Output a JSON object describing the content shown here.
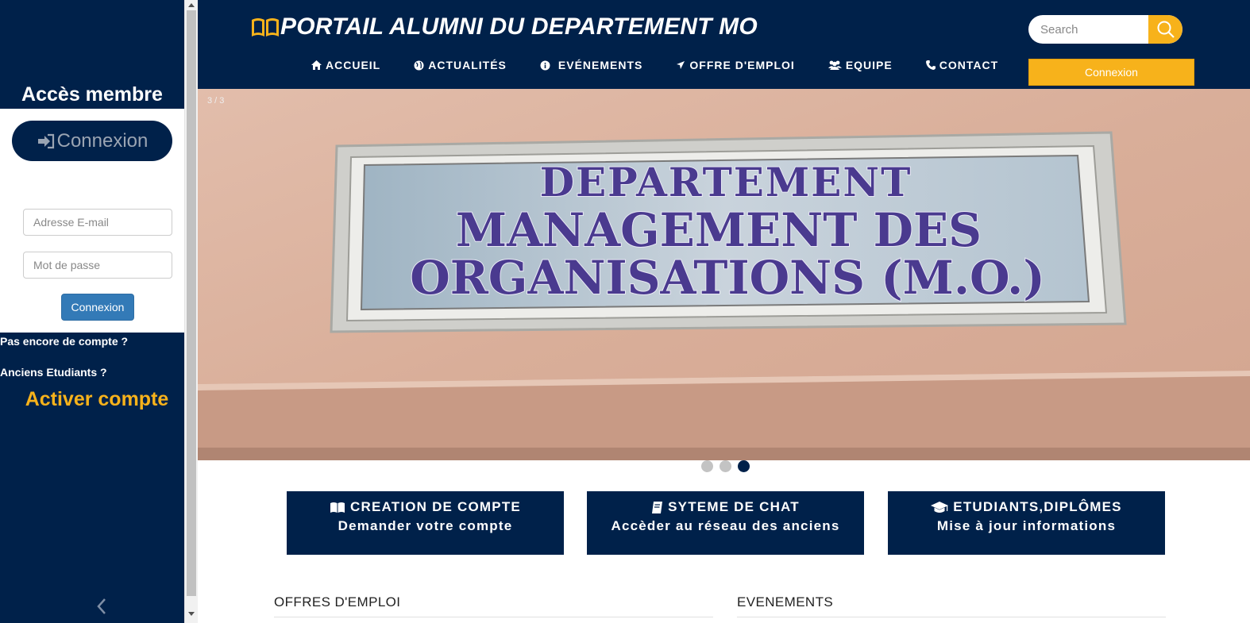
{
  "sidebar": {
    "title": "Accès membre",
    "connect_pill": "Connexion",
    "email_placeholder": "Adresse E-mail",
    "password_placeholder": "Mot de passe",
    "submit": "Connexion",
    "no_account": "Pas encore de compte ?",
    "old_students": "Anciens Etudiants ?",
    "activate": "Activer compte"
  },
  "header": {
    "title": "PORTAIL ALUMNI DU DEPARTEMENT MO",
    "search_placeholder": "Search",
    "nav": [
      {
        "label": "ACCUEIL",
        "icon": "home-icon"
      },
      {
        "label": "ACTUALITÉS",
        "icon": "globe-icon"
      },
      {
        "label": "EVÉNEMENTS",
        "icon": "info-icon"
      },
      {
        "label": "OFFRE D'EMPLOI",
        "icon": "plane-icon"
      },
      {
        "label": "EQUIPE",
        "icon": "users-icon"
      },
      {
        "label": "CONTACT",
        "icon": "phone-icon"
      }
    ],
    "login_button": "Connexion"
  },
  "slider": {
    "counter": "3 / 3",
    "sign_line1": "DEPARTEMENT",
    "sign_line2": "MANAGEMENT DES",
    "sign_line3": "ORGANISATIONS (M.O.)",
    "active_index": 2,
    "total": 3
  },
  "features": [
    {
      "title": "CREATION DE COMPTE",
      "subtitle": "Demander votre compte",
      "icon": "book-icon"
    },
    {
      "title": "SYTEME DE CHAT",
      "subtitle": "Accèder au réseau des anciens",
      "icon": "notebook-icon"
    },
    {
      "title": "ETUDIANTS,DIPLÔMES",
      "subtitle": "Mise à jour informations",
      "icon": "graduation-cap-icon"
    }
  ],
  "sections": {
    "jobs": "OFFRES D'EMPLOI",
    "events": "EVENEMENTS"
  },
  "colors": {
    "navy": "#00214a",
    "accent": "#f7b21b",
    "button_blue": "#337ab7"
  }
}
